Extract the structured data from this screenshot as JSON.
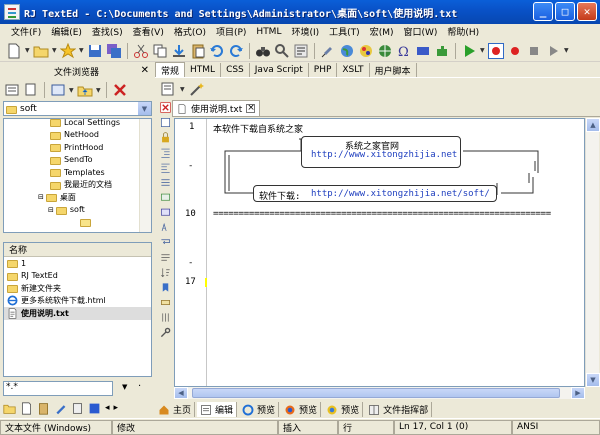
{
  "window": {
    "title": "RJ TextEd - C:\\Documents and Settings\\Administrator\\桌面\\soft\\使用说明.txt"
  },
  "menu": [
    "文件(F)",
    "编辑(E)",
    "查找(S)",
    "查看(V)",
    "格式(O)",
    "项目(P)",
    "HTML",
    "环境(I)",
    "工具(T)",
    "宏(M)",
    "窗口(W)",
    "帮助(H)"
  ],
  "left_panel": {
    "title": "文件浏览器",
    "combo_value": "soft",
    "tree": [
      {
        "label": "Local Settings",
        "level": 2
      },
      {
        "label": "NetHood",
        "level": 2
      },
      {
        "label": "PrintHood",
        "level": 2
      },
      {
        "label": "SendTo",
        "level": 2
      },
      {
        "label": "Templates",
        "level": 2
      },
      {
        "label": "我最近的文档",
        "level": 2
      },
      {
        "label": "桌面",
        "level": 1
      },
      {
        "label": "soft",
        "level": 2
      },
      {
        "label": "",
        "level": 3
      }
    ],
    "list_header": "名称",
    "files": [
      {
        "name": "1",
        "type": "folder"
      },
      {
        "name": "RJ TextEd",
        "type": "folder"
      },
      {
        "name": "新建文件夹",
        "type": "folder"
      },
      {
        "name": "更多系统软件下载.html",
        "type": "html"
      },
      {
        "name": "使用说明.txt",
        "type": "txt",
        "selected": true
      }
    ],
    "filter_value": "*.*"
  },
  "tabs": [
    "常规",
    "HTML",
    "CSS",
    "Java Script",
    "PHP",
    "XSLT",
    "用户脚本"
  ],
  "document_tab": "使用说明.txt",
  "editor": {
    "line_numbers": [
      "1",
      "-",
      "10",
      "-",
      "17"
    ],
    "line1": "本软件下载自系统之家",
    "box1_title": "系统之家官网",
    "box1_url": "http://www.xitongzhijia.net",
    "box2_label": "软件下载:",
    "box2_url": "http://www.xitongzhijia.net/soft/",
    "separator": "=================================================================="
  },
  "view_tabs": [
    "主页",
    "编辑",
    "预览",
    "预览",
    "预览",
    "文件指挥部"
  ],
  "status": {
    "filetype": "文本文件 (Windows)",
    "modified": "修改",
    "insert": "插入",
    "mode": "行",
    "position": "Ln 17, Col 1 (0)",
    "encoding": "ANSI"
  }
}
